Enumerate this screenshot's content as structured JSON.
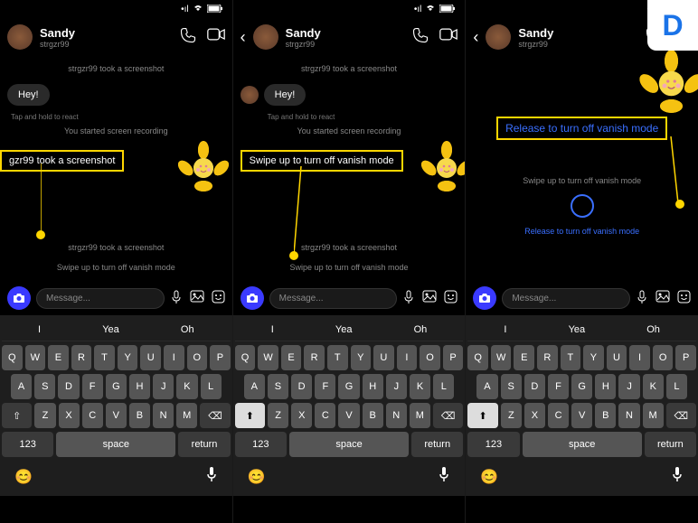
{
  "contact": {
    "name": "Sandy",
    "handle": "strgzr99"
  },
  "sys": {
    "screenshot": "strgzr99 took a screenshot",
    "screen_recording": "You started screen recording",
    "swipe_vanish": "Swipe up to turn off vanish mode",
    "release_vanish": "Release to turn off vanish mode"
  },
  "msg": {
    "hey": "Hey!",
    "react_hint": "Tap and hold to react"
  },
  "highlights": {
    "s1": "gzr99 took a screenshot",
    "s2": "Swipe up to turn off vanish mode",
    "s3": "Release to turn off vanish mode"
  },
  "input": {
    "placeholder": "Message..."
  },
  "suggestions": [
    "I",
    "Yea",
    "Oh"
  ],
  "keyboard": {
    "row1": [
      "Q",
      "W",
      "E",
      "R",
      "T",
      "Y",
      "U",
      "I",
      "O",
      "P"
    ],
    "row2": [
      "A",
      "S",
      "D",
      "F",
      "G",
      "H",
      "J",
      "K",
      "L"
    ],
    "row3": [
      "Z",
      "X",
      "C",
      "V",
      "B",
      "N",
      "M"
    ],
    "bottom": {
      "num": "123",
      "space": "space",
      "return": "return"
    }
  },
  "logo": "D"
}
